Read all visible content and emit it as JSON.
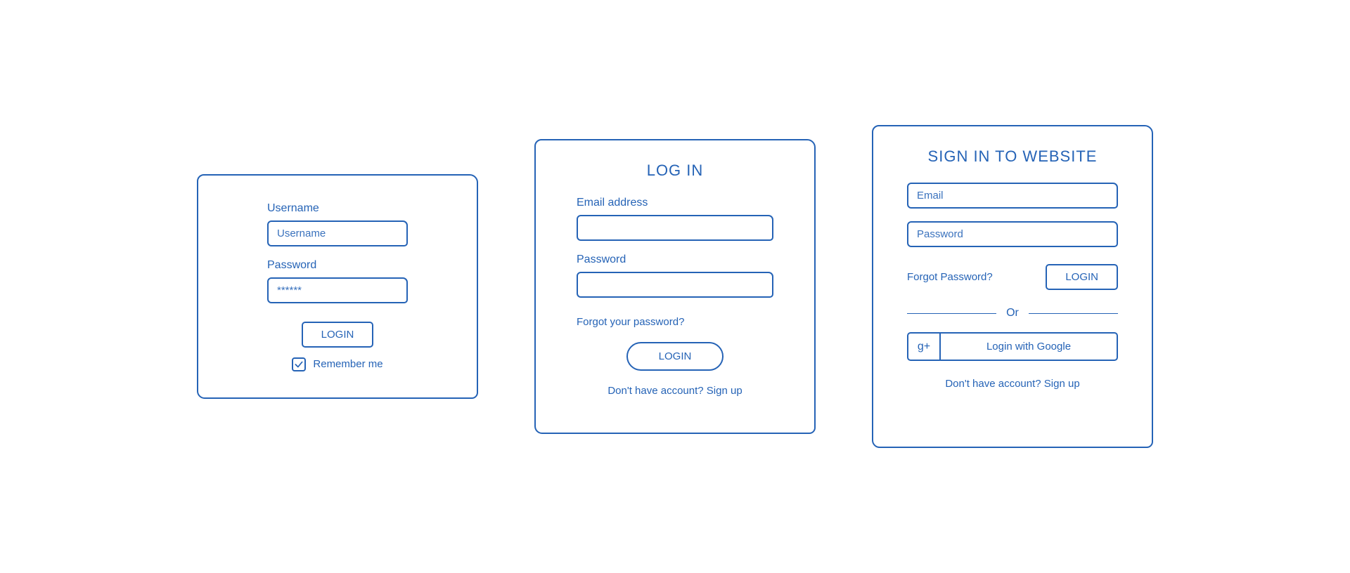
{
  "form1": {
    "username_label": "Username",
    "username_placeholder": "Username",
    "password_label": "Password",
    "password_placeholder": "******",
    "login_button": "LOGIN",
    "remember_checked": true,
    "remember_label": "Remember me"
  },
  "form2": {
    "title": "LOG IN",
    "email_label": "Email address",
    "password_label": "Password",
    "forgot_link": "Forgot your password?",
    "login_button": "LOGIN",
    "signup_link": "Don't have account? Sign up"
  },
  "form3": {
    "title": "SIGN IN TO WEBSITE",
    "email_placeholder": "Email",
    "password_placeholder": "Password",
    "forgot_link": "Forgot Password?",
    "login_button": "LOGIN",
    "or_label": "Or",
    "google_icon": "g+",
    "google_label": "Login with Google",
    "signup_link": "Don't have account? Sign up"
  }
}
